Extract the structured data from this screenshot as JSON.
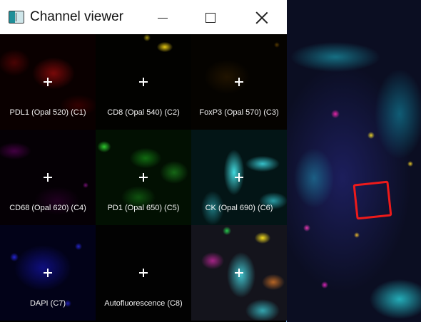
{
  "window": {
    "title": "Channel viewer"
  },
  "channels": [
    {
      "label": "PDL1 (Opal 520) (C1)",
      "color": "#8c0a0a"
    },
    {
      "label": "CD8 (Opal 540) (C2)",
      "color": "#f0d214"
    },
    {
      "label": "FoxP3 (Opal 570) (C3)",
      "color": "#785000"
    },
    {
      "label": "CD68 (Opal 620) (C4)",
      "color": "#8c148c"
    },
    {
      "label": "PD1 (Opal 650) (C5)",
      "color": "#32dc32"
    },
    {
      "label": "CK (Opal 690) (C6)",
      "color": "#46e6eb"
    },
    {
      "label": "DAPI (C7)",
      "color": "#2828e6"
    },
    {
      "label": "Autofluorescence (C8)",
      "color": "#020202"
    },
    {
      "label": "",
      "color": "composite"
    }
  ],
  "icons": {
    "app": "channel-viewer-icon",
    "minimize": "minimize-icon",
    "maximize": "maximize-icon",
    "close": "close-icon",
    "crosshair": "crosshair-icon"
  },
  "roi": {
    "color": "#ee1a1a"
  }
}
